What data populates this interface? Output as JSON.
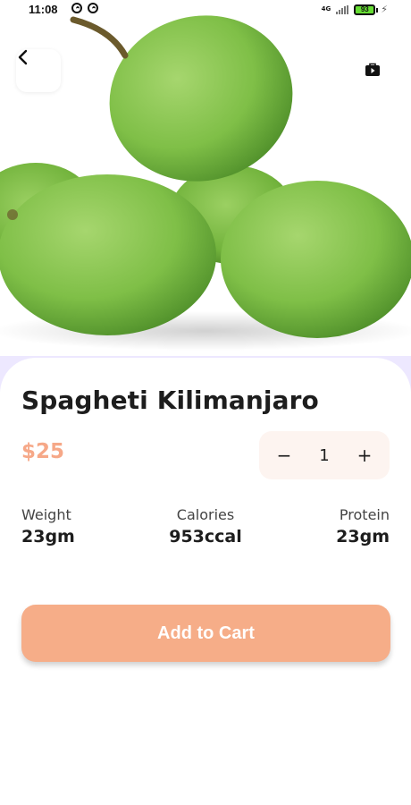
{
  "status_bar": {
    "time": "11:08",
    "network": "4G",
    "battery": "93"
  },
  "header": {
    "back_icon": "chevron-left-icon",
    "share_icon": "bag-play-icon"
  },
  "hero": {
    "image": "green-mangoes-photo"
  },
  "product": {
    "title": "Spagheti Kilimanjaro",
    "price": "$25",
    "quantity": "1",
    "minus_label": "−",
    "plus_label": "+"
  },
  "stats": [
    {
      "label": "Weight",
      "value": "23gm"
    },
    {
      "label": "Calories",
      "value": "953ccal"
    },
    {
      "label": "Protein",
      "value": "23gm"
    }
  ],
  "cta": {
    "add_to_cart": "Add to Cart"
  },
  "colors": {
    "accent": "#f6ad88",
    "price": "#f6a888",
    "stepper_bg": "#fdf4f0",
    "sheet_backdrop": "#ede8ff"
  }
}
